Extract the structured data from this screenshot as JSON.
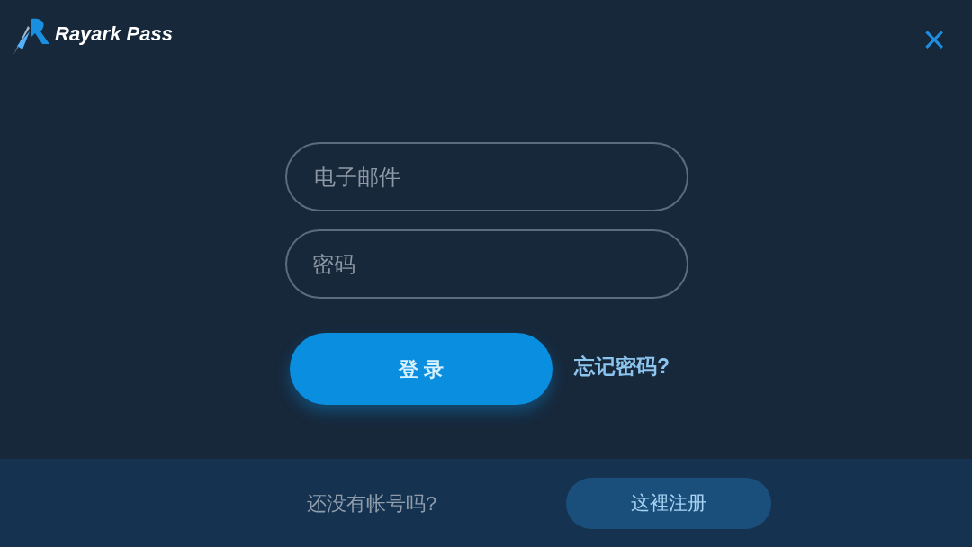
{
  "header": {
    "logo_text": "Rayark Pass",
    "close": "×"
  },
  "form": {
    "email": {
      "placeholder": "电子邮件"
    },
    "password": {
      "placeholder": "密码"
    },
    "login_button": "登 录",
    "forgot_link": "忘记密码?"
  },
  "footer": {
    "prompt": "还没有帐号吗?",
    "register_button": "这裡注册"
  }
}
